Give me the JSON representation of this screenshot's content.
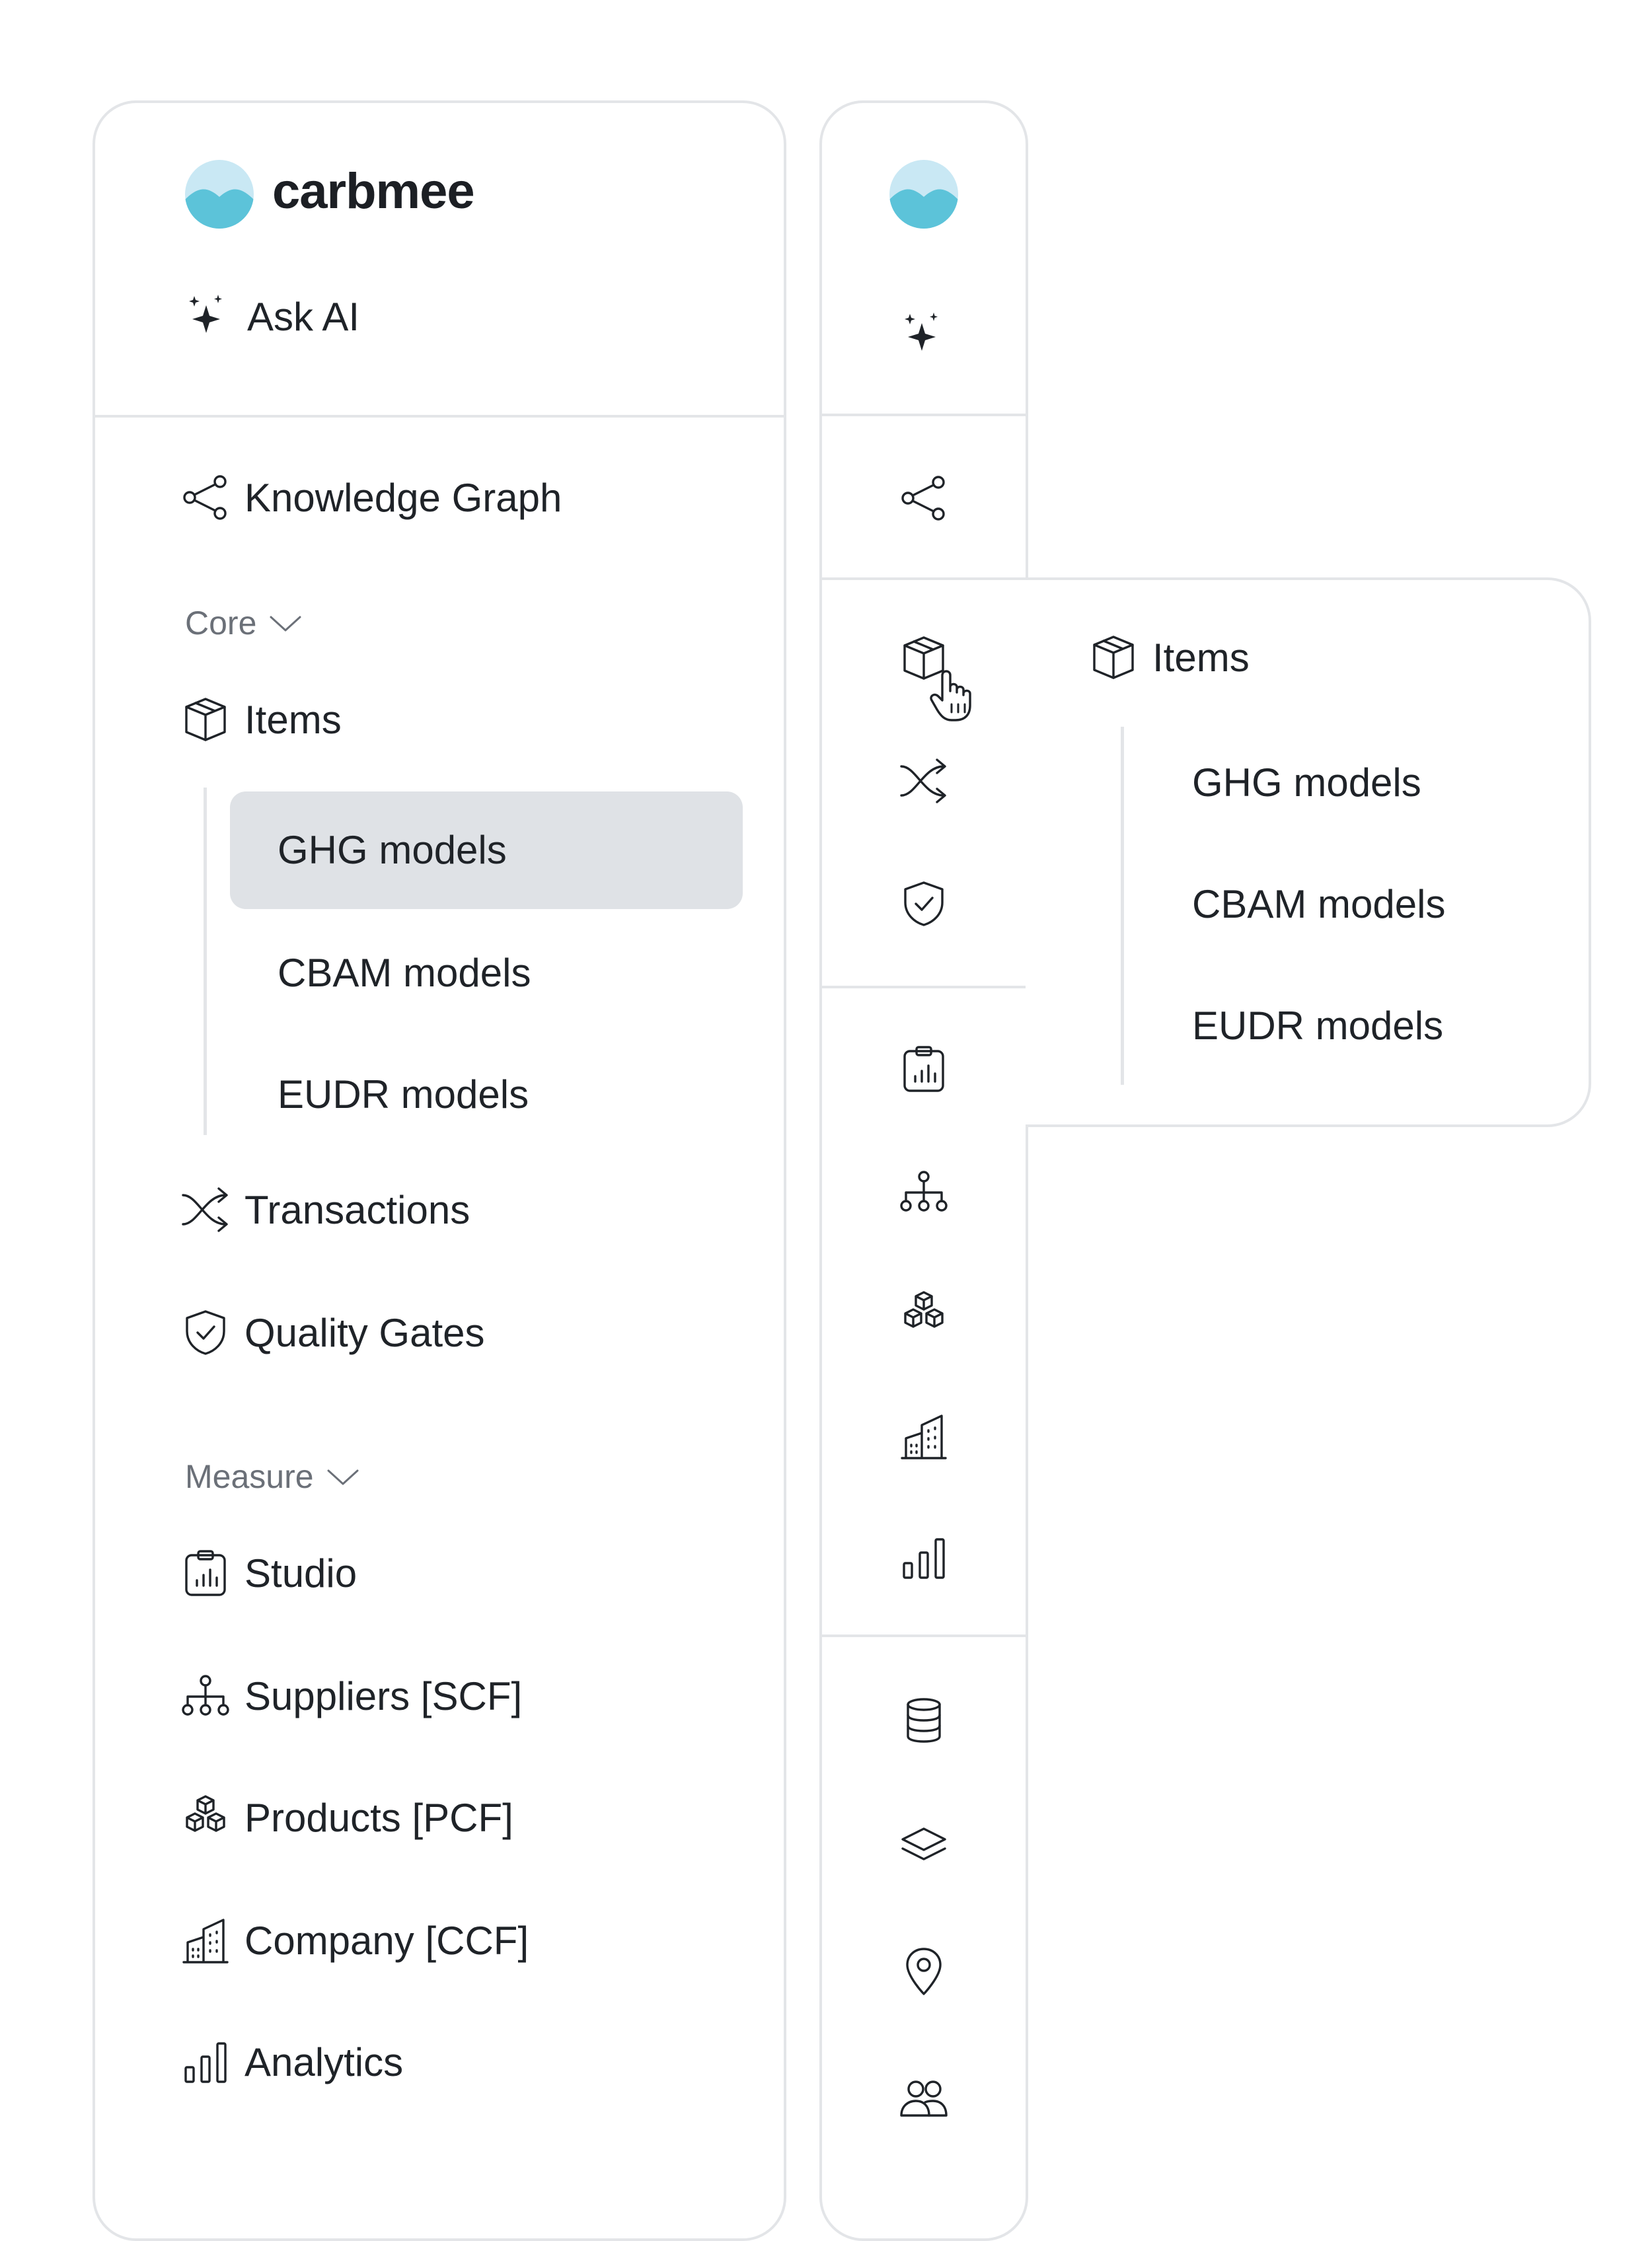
{
  "brand": {
    "name": "carbmee",
    "colors": {
      "mark_light": "#c9e8f4",
      "mark_dark": "#5cc3d9",
      "highlight_bg": "#dfe2e6",
      "border": "#e3e5e8"
    }
  },
  "top": {
    "ask_ai": "Ask AI"
  },
  "nav": {
    "knowledge_graph": "Knowledge Graph",
    "core_section": "Core",
    "items": "Items",
    "items_sub": [
      "GHG models",
      "CBAM models",
      "EUDR models"
    ],
    "transactions": "Transactions",
    "quality_gates": "Quality Gates",
    "measure_section": "Measure",
    "studio": "Studio",
    "suppliers": "Suppliers [SCF]",
    "products": "Products [PCF]",
    "company": "Company [CCF]",
    "analytics": "Analytics"
  },
  "flyout": {
    "title": "Items",
    "items": [
      "GHG models",
      "CBAM models",
      "EUDR models"
    ]
  },
  "rail_icons": [
    "logo",
    "sparkles-icon",
    "share-icon",
    "cube-icon",
    "shuffle-icon",
    "shield-check-icon",
    "clipboard-chart-icon",
    "hierarchy-icon",
    "cubes-icon",
    "buildings-icon",
    "bar-chart-icon",
    "database-icon",
    "layers-icon",
    "location-pin-icon",
    "users-icon"
  ]
}
